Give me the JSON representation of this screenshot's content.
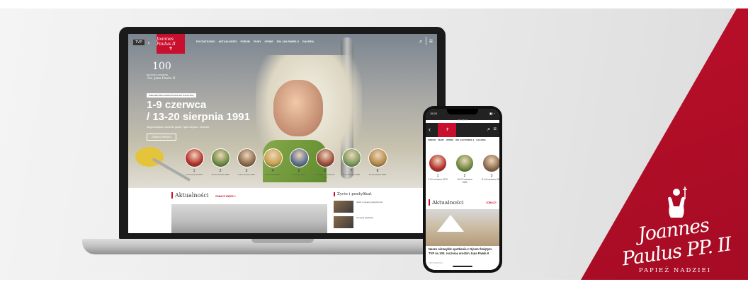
{
  "colors": {
    "brand_red": "#c8102e",
    "dark": "#1a1a1a",
    "white": "#ffffff"
  },
  "laptop": {
    "nav": {
      "badge": "TVP",
      "back_icon": "chevron-left-icon",
      "logo_signature": "Joannes Paulus II",
      "menu": [
        "POCZĄTKOWO",
        "AKTUALNOŚCI",
        "FORUM",
        "FILMY",
        "OPINIE",
        "ŚW. JAN PAWEŁ II",
        "GALERIA"
      ],
      "search_icon": "search-icon",
      "menu_icon": "hamburger-icon"
    },
    "hero": {
      "number": "100",
      "sub": "ROCZNICA URODZIN",
      "name": "Św. Jana Pawła II",
      "pill": "PIELGRZYMKA APOSTOLSKA DO OJCZYZNY",
      "headline_line1": "1-9 czerwca",
      "headline_line2": "/ 13-20 sierpnia 1991",
      "quote": "„Bogu dziękujcie, ducha nie gaście” Tylko Chrystus – Mocność",
      "more_button": "ZOBACZ WIĘCEJ"
    },
    "timeline": [
      {
        "num": "1",
        "date": "2-10 czerwca 1979"
      },
      {
        "num": "2",
        "date": "16-23 czerwca 1983"
      },
      {
        "num": "3",
        "date": "8-14 czerwca 1987"
      },
      {
        "num": "4",
        "date": "1-9 czerwca 1991"
      },
      {
        "num": "5",
        "date": "22 maja 1995"
      },
      {
        "num": "6",
        "date": "31 maja - 10 czerwca 1997"
      },
      {
        "num": "7",
        "date": "5-17 czerwca 1999"
      },
      {
        "num": "8",
        "date": "16-19 sierpnia 2002"
      }
    ],
    "news": {
      "title": "Aktualności",
      "more": "ZOBACZ WIĘCEJ ›",
      "side_title": "Życie i pontyfikat",
      "side_items": [
        "Jedni z tysięcy pielgrzymów",
        "Z wizytą papieską"
      ]
    }
  },
  "phone": {
    "status_time": "15:20",
    "url": "jp2.tvp.pl",
    "tabs": [
      "FORUM",
      "FILMY",
      "OPINIE",
      "ŚW. JAN PAWEŁ II",
      "GALERIA"
    ],
    "timeline": [
      {
        "num": "1",
        "date": "2-10 czerwca 1979"
      },
      {
        "num": "2",
        "date": "16-23 czerwca 1983"
      },
      {
        "num": "3",
        "date": "8-14 czerwca 1987"
      }
    ],
    "news_title": "Aktualności",
    "news_more": "ZOBACZ ›",
    "caption": "Nasze niezwykłe spotkania z Ojcem Świętym. TVP na 100. rocznicę urodzin Jana Pawła II",
    "tag": "AKTUALNOŚCI"
  },
  "brand": {
    "signature": "Joannes Paulus PP. II",
    "subtitle": "PAPIEŻ NADZIEI",
    "figure_icon": "pope-figure-icon"
  }
}
